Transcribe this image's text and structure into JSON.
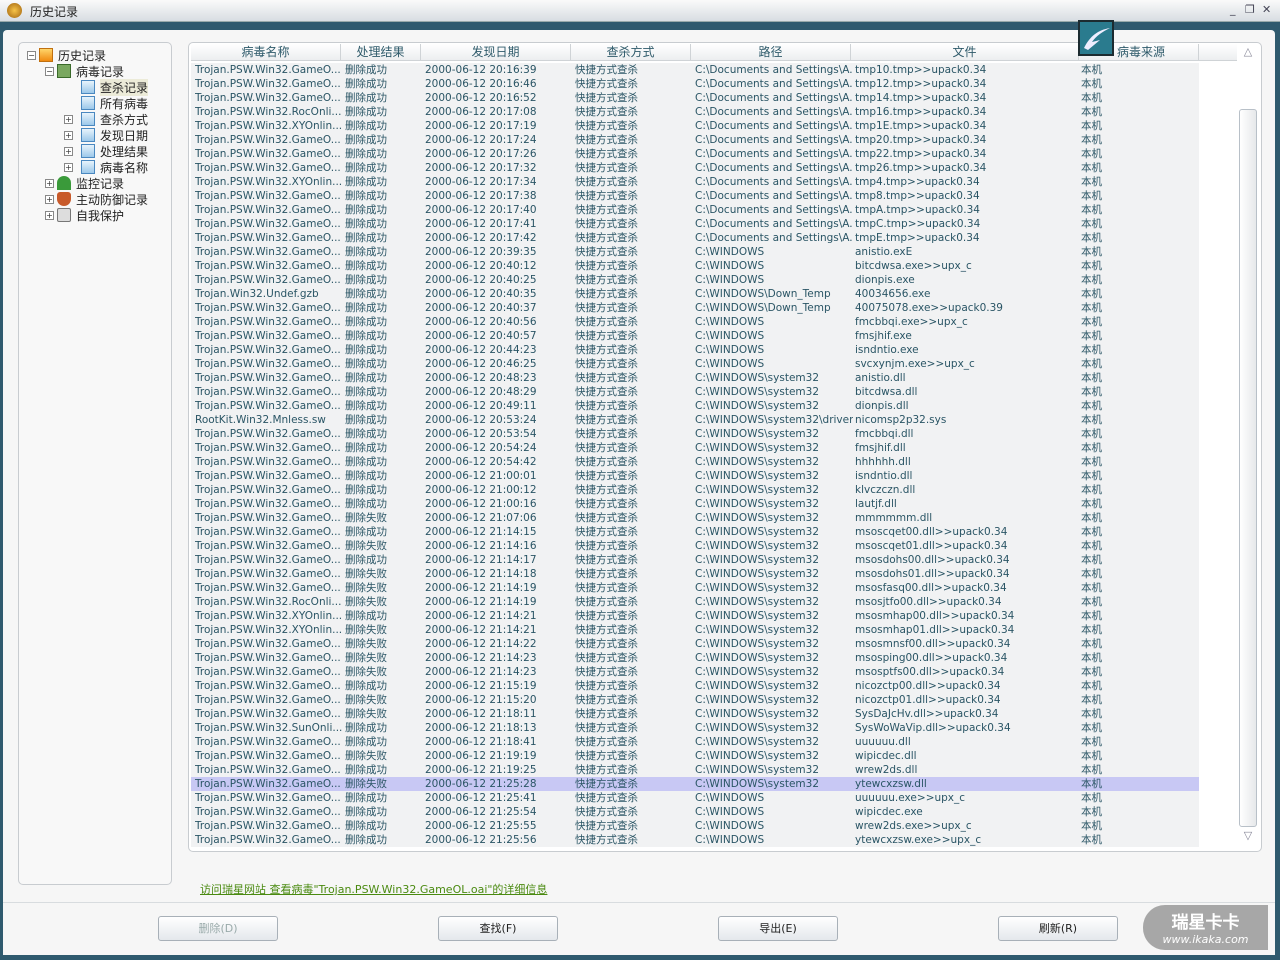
{
  "window": {
    "title": "历史记录",
    "minimize": "_",
    "restore": "❐",
    "close": "✕"
  },
  "tree": {
    "root": "历史记录",
    "virus_records": "病毒记录",
    "children": [
      "查杀记录",
      "所有病毒",
      "查杀方式",
      "发现日期",
      "处理结果",
      "病毒名称"
    ],
    "monitor": "监控记录",
    "defense": "主动防御记录",
    "selfprotect": "自我保护",
    "selected": "查杀记录"
  },
  "table": {
    "columns": [
      "病毒名称",
      "处理结果",
      "发现日期",
      "查杀方式",
      "路径",
      "文件",
      "病毒来源"
    ],
    "selected_index": 51,
    "rows": [
      [
        "Trojan.PSW.Win32.GameO...",
        "删除成功",
        "2000-06-12 20:16:39",
        "快捷方式查杀",
        "C:\\Documents and Settings\\A...",
        "tmp10.tmp>>upack0.34",
        "本机"
      ],
      [
        "Trojan.PSW.Win32.GameO...",
        "删除成功",
        "2000-06-12 20:16:46",
        "快捷方式查杀",
        "C:\\Documents and Settings\\A...",
        "tmp12.tmp>>upack0.34",
        "本机"
      ],
      [
        "Trojan.PSW.Win32.GameO...",
        "删除成功",
        "2000-06-12 20:16:52",
        "快捷方式查杀",
        "C:\\Documents and Settings\\A...",
        "tmp14.tmp>>upack0.34",
        "本机"
      ],
      [
        "Trojan.PSW.Win32.RocOnli...",
        "删除成功",
        "2000-06-12 20:17:08",
        "快捷方式查杀",
        "C:\\Documents and Settings\\A...",
        "tmp16.tmp>>upack0.34",
        "本机"
      ],
      [
        "Trojan.PSW.Win32.XYOnlin...",
        "删除成功",
        "2000-06-12 20:17:19",
        "快捷方式查杀",
        "C:\\Documents and Settings\\A...",
        "tmp1E.tmp>>upack0.34",
        "本机"
      ],
      [
        "Trojan.PSW.Win32.GameO...",
        "删除成功",
        "2000-06-12 20:17:24",
        "快捷方式查杀",
        "C:\\Documents and Settings\\A...",
        "tmp20.tmp>>upack0.34",
        "本机"
      ],
      [
        "Trojan.PSW.Win32.GameO...",
        "删除成功",
        "2000-06-12 20:17:26",
        "快捷方式查杀",
        "C:\\Documents and Settings\\A...",
        "tmp22.tmp>>upack0.34",
        "本机"
      ],
      [
        "Trojan.PSW.Win32.GameO...",
        "删除成功",
        "2000-06-12 20:17:32",
        "快捷方式查杀",
        "C:\\Documents and Settings\\A...",
        "tmp26.tmp>>upack0.34",
        "本机"
      ],
      [
        "Trojan.PSW.Win32.XYOnlin...",
        "删除成功",
        "2000-06-12 20:17:34",
        "快捷方式查杀",
        "C:\\Documents and Settings\\A...",
        "tmp4.tmp>>upack0.34",
        "本机"
      ],
      [
        "Trojan.PSW.Win32.GameO...",
        "删除成功",
        "2000-06-12 20:17:38",
        "快捷方式查杀",
        "C:\\Documents and Settings\\A...",
        "tmp8.tmp>>upack0.34",
        "本机"
      ],
      [
        "Trojan.PSW.Win32.GameO...",
        "删除成功",
        "2000-06-12 20:17:40",
        "快捷方式查杀",
        "C:\\Documents and Settings\\A...",
        "tmpA.tmp>>upack0.34",
        "本机"
      ],
      [
        "Trojan.PSW.Win32.GameO...",
        "删除成功",
        "2000-06-12 20:17:41",
        "快捷方式查杀",
        "C:\\Documents and Settings\\A...",
        "tmpC.tmp>>upack0.34",
        "本机"
      ],
      [
        "Trojan.PSW.Win32.GameO...",
        "删除成功",
        "2000-06-12 20:17:42",
        "快捷方式查杀",
        "C:\\Documents and Settings\\A...",
        "tmpE.tmp>>upack0.34",
        "本机"
      ],
      [
        "Trojan.PSW.Win32.GameO...",
        "删除成功",
        "2000-06-12 20:39:35",
        "快捷方式查杀",
        "C:\\WINDOWS",
        "anistio.exE",
        "本机"
      ],
      [
        "Trojan.PSW.Win32.GameO...",
        "删除成功",
        "2000-06-12 20:40:12",
        "快捷方式查杀",
        "C:\\WINDOWS",
        "bitcdwsa.exe>>upx_c",
        "本机"
      ],
      [
        "Trojan.PSW.Win32.GameO...",
        "删除成功",
        "2000-06-12 20:40:25",
        "快捷方式查杀",
        "C:\\WINDOWS",
        "dionpis.exe",
        "本机"
      ],
      [
        "Trojan.Win32.Undef.gzb",
        "删除成功",
        "2000-06-12 20:40:35",
        "快捷方式查杀",
        "C:\\WINDOWS\\Down_Temp",
        "40034656.exe",
        "本机"
      ],
      [
        "Trojan.PSW.Win32.GameO...",
        "删除成功",
        "2000-06-12 20:40:37",
        "快捷方式查杀",
        "C:\\WINDOWS\\Down_Temp",
        "40075078.exe>>upack0.39",
        "本机"
      ],
      [
        "Trojan.PSW.Win32.GameO...",
        "删除成功",
        "2000-06-12 20:40:56",
        "快捷方式查杀",
        "C:\\WINDOWS",
        "fmcbbqi.exe>>upx_c",
        "本机"
      ],
      [
        "Trojan.PSW.Win32.GameO...",
        "删除成功",
        "2000-06-12 20:40:57",
        "快捷方式查杀",
        "C:\\WINDOWS",
        "fmsjhif.exe",
        "本机"
      ],
      [
        "Trojan.PSW.Win32.GameO...",
        "删除成功",
        "2000-06-12 20:44:23",
        "快捷方式查杀",
        "C:\\WINDOWS",
        "isndntio.exe",
        "本机"
      ],
      [
        "Trojan.PSW.Win32.GameO...",
        "删除成功",
        "2000-06-12 20:46:25",
        "快捷方式查杀",
        "C:\\WINDOWS",
        "svcxynjm.exe>>upx_c",
        "本机"
      ],
      [
        "Trojan.PSW.Win32.GameO...",
        "删除成功",
        "2000-06-12 20:48:23",
        "快捷方式查杀",
        "C:\\WINDOWS\\system32",
        "anistio.dll",
        "本机"
      ],
      [
        "Trojan.PSW.Win32.GameO...",
        "删除成功",
        "2000-06-12 20:48:29",
        "快捷方式查杀",
        "C:\\WINDOWS\\system32",
        "bitcdwsa.dll",
        "本机"
      ],
      [
        "Trojan.PSW.Win32.GameO...",
        "删除成功",
        "2000-06-12 20:49:11",
        "快捷方式查杀",
        "C:\\WINDOWS\\system32",
        "dionpis.dll",
        "本机"
      ],
      [
        "RootKit.Win32.Mnless.sw",
        "删除成功",
        "2000-06-12 20:53:24",
        "快捷方式查杀",
        "C:\\WINDOWS\\system32\\drivers",
        "nicomsp2p32.sys",
        "本机"
      ],
      [
        "Trojan.PSW.Win32.GameO...",
        "删除成功",
        "2000-06-12 20:53:54",
        "快捷方式查杀",
        "C:\\WINDOWS\\system32",
        "fmcbbqi.dll",
        "本机"
      ],
      [
        "Trojan.PSW.Win32.GameO...",
        "删除成功",
        "2000-06-12 20:54:24",
        "快捷方式查杀",
        "C:\\WINDOWS\\system32",
        "fmsjhif.dll",
        "本机"
      ],
      [
        "Trojan.PSW.Win32.GameO...",
        "删除成功",
        "2000-06-12 20:54:42",
        "快捷方式查杀",
        "C:\\WINDOWS\\system32",
        "hhhhhh.dll",
        "本机"
      ],
      [
        "Trojan.PSW.Win32.GameO...",
        "删除成功",
        "2000-06-12 21:00:01",
        "快捷方式查杀",
        "C:\\WINDOWS\\system32",
        "isndntio.dll",
        "本机"
      ],
      [
        "Trojan.PSW.Win32.GameO...",
        "删除成功",
        "2000-06-12 21:00:12",
        "快捷方式查杀",
        "C:\\WINDOWS\\system32",
        "klvczczn.dll",
        "本机"
      ],
      [
        "Trojan.PSW.Win32.GameO...",
        "删除成功",
        "2000-06-12 21:00:16",
        "快捷方式查杀",
        "C:\\WINDOWS\\system32",
        "lautjf.dll",
        "本机"
      ],
      [
        "Trojan.PSW.Win32.GameO...",
        "删除失败",
        "2000-06-12 21:07:06",
        "快捷方式查杀",
        "C:\\WINDOWS\\system32",
        "mmmmmm.dll",
        "本机"
      ],
      [
        "Trojan.PSW.Win32.GameO...",
        "删除成功",
        "2000-06-12 21:14:15",
        "快捷方式查杀",
        "C:\\WINDOWS\\system32",
        "msoscqet00.dll>>upack0.34",
        "本机"
      ],
      [
        "Trojan.PSW.Win32.GameO...",
        "删除失败",
        "2000-06-12 21:14:16",
        "快捷方式查杀",
        "C:\\WINDOWS\\system32",
        "msoscqet01.dll>>upack0.34",
        "本机"
      ],
      [
        "Trojan.PSW.Win32.GameO...",
        "删除成功",
        "2000-06-12 21:14:17",
        "快捷方式查杀",
        "C:\\WINDOWS\\system32",
        "msosdohs00.dll>>upack0.34",
        "本机"
      ],
      [
        "Trojan.PSW.Win32.GameO...",
        "删除失败",
        "2000-06-12 21:14:18",
        "快捷方式查杀",
        "C:\\WINDOWS\\system32",
        "msosdohs01.dll>>upack0.34",
        "本机"
      ],
      [
        "Trojan.PSW.Win32.GameO...",
        "删除失败",
        "2000-06-12 21:14:19",
        "快捷方式查杀",
        "C:\\WINDOWS\\system32",
        "msosfasq00.dll>>upack0.34",
        "本机"
      ],
      [
        "Trojan.PSW.Win32.RocOnli...",
        "删除失败",
        "2000-06-12 21:14:19",
        "快捷方式查杀",
        "C:\\WINDOWS\\system32",
        "msosjtfo00.dll>>upack0.34",
        "本机"
      ],
      [
        "Trojan.PSW.Win32.XYOnlin...",
        "删除成功",
        "2000-06-12 21:14:21",
        "快捷方式查杀",
        "C:\\WINDOWS\\system32",
        "msosmhap00.dll>>upack0.34",
        "本机"
      ],
      [
        "Trojan.PSW.Win32.XYOnlin...",
        "删除失败",
        "2000-06-12 21:14:21",
        "快捷方式查杀",
        "C:\\WINDOWS\\system32",
        "msosmhap01.dll>>upack0.34",
        "本机"
      ],
      [
        "Trojan.PSW.Win32.GameO...",
        "删除失败",
        "2000-06-12 21:14:22",
        "快捷方式查杀",
        "C:\\WINDOWS\\system32",
        "msosmnsf00.dll>>upack0.34",
        "本机"
      ],
      [
        "Trojan.PSW.Win32.GameO...",
        "删除失败",
        "2000-06-12 21:14:23",
        "快捷方式查杀",
        "C:\\WINDOWS\\system32",
        "msosping00.dll>>upack0.34",
        "本机"
      ],
      [
        "Trojan.PSW.Win32.GameO...",
        "删除失败",
        "2000-06-12 21:14:23",
        "快捷方式查杀",
        "C:\\WINDOWS\\system32",
        "msosptfs00.dll>>upack0.34",
        "本机"
      ],
      [
        "Trojan.PSW.Win32.GameO...",
        "删除成功",
        "2000-06-12 21:15:19",
        "快捷方式查杀",
        "C:\\WINDOWS\\system32",
        "nicozctp00.dll>>upack0.34",
        "本机"
      ],
      [
        "Trojan.PSW.Win32.GameO...",
        "删除失败",
        "2000-06-12 21:15:20",
        "快捷方式查杀",
        "C:\\WINDOWS\\system32",
        "nicozctp01.dll>>upack0.34",
        "本机"
      ],
      [
        "Trojan.PSW.Win32.GameO...",
        "删除失败",
        "2000-06-12 21:18:11",
        "快捷方式查杀",
        "C:\\WINDOWS\\system32",
        "SysDaJcHv.dll>>upack0.34",
        "本机"
      ],
      [
        "Trojan.PSW.Win32.SunOnli...",
        "删除成功",
        "2000-06-12 21:18:13",
        "快捷方式查杀",
        "C:\\WINDOWS\\system32",
        "SysWoWaVip.dll>>upack0.34",
        "本机"
      ],
      [
        "Trojan.PSW.Win32.GameO...",
        "删除成功",
        "2000-06-12 21:18:41",
        "快捷方式查杀",
        "C:\\WINDOWS\\system32",
        "uuuuuu.dll",
        "本机"
      ],
      [
        "Trojan.PSW.Win32.GameO...",
        "删除失败",
        "2000-06-12 21:19:19",
        "快捷方式查杀",
        "C:\\WINDOWS\\system32",
        "wipicdec.dll",
        "本机"
      ],
      [
        "Trojan.PSW.Win32.GameO...",
        "删除成功",
        "2000-06-12 21:19:25",
        "快捷方式查杀",
        "C:\\WINDOWS\\system32",
        "wrew2ds.dll",
        "本机"
      ],
      [
        "Trojan.PSW.Win32.GameO...",
        "删除失败",
        "2000-06-12 21:25:28",
        "快捷方式查杀",
        "C:\\WINDOWS\\system32",
        "ytewcxzsw.dll",
        "本机"
      ],
      [
        "Trojan.PSW.Win32.GameO...",
        "删除成功",
        "2000-06-12 21:25:41",
        "快捷方式查杀",
        "C:\\WINDOWS",
        "uuuuuu.exe>>upx_c",
        "本机"
      ],
      [
        "Trojan.PSW.Win32.GameO...",
        "删除成功",
        "2000-06-12 21:25:54",
        "快捷方式查杀",
        "C:\\WINDOWS",
        "wipicdec.exe",
        "本机"
      ],
      [
        "Trojan.PSW.Win32.GameO...",
        "删除成功",
        "2000-06-12 21:25:55",
        "快捷方式查杀",
        "C:\\WINDOWS",
        "wrew2ds.exe>>upx_c",
        "本机"
      ],
      [
        "Trojan.PSW.Win32.GameO...",
        "删除成功",
        "2000-06-12 21:25:56",
        "快捷方式查杀",
        "C:\\WINDOWS",
        "ytewcxzsw.exe>>upx_c",
        "本机"
      ]
    ]
  },
  "scrollbar": {
    "up": "△",
    "down": "▽"
  },
  "detail_link": "访问瑞星网站 查看病毒\"Trojan.PSW.Win32.GameOL.oai\"的详细信息",
  "buttons": {
    "delete": "删除(D)",
    "find": "查找(F)",
    "export": "导出(E)",
    "refresh": "刷新(R)"
  },
  "watermark": {
    "brand": "瑞星卡卡",
    "url": "www.ikaka.com"
  },
  "colors": {
    "selected_row": "#c8c8f4",
    "link": "#4a8a10",
    "frame": "#2f5a6e"
  }
}
